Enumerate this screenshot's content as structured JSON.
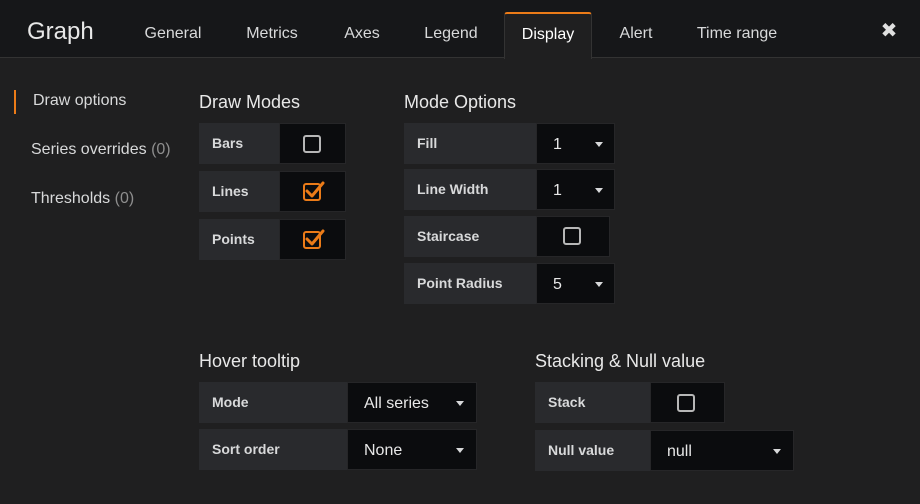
{
  "header": {
    "panel_title": "Graph",
    "tabs": [
      {
        "label": "General"
      },
      {
        "label": "Metrics"
      },
      {
        "label": "Axes"
      },
      {
        "label": "Legend"
      },
      {
        "label": "Display",
        "active": true
      },
      {
        "label": "Alert"
      },
      {
        "label": "Time range"
      }
    ],
    "close_glyph": "✖"
  },
  "sidebar": {
    "items": [
      {
        "label": "Draw options",
        "count": "",
        "active": true
      },
      {
        "label": "Series overrides",
        "count": "(0)"
      },
      {
        "label": "Thresholds",
        "count": "(0)"
      }
    ]
  },
  "draw_modes": {
    "title": "Draw Modes",
    "bars": {
      "label": "Bars",
      "checked": false
    },
    "lines": {
      "label": "Lines",
      "checked": true
    },
    "points": {
      "label": "Points",
      "checked": true
    }
  },
  "mode_options": {
    "title": "Mode Options",
    "fill": {
      "label": "Fill",
      "value": "1"
    },
    "line_width": {
      "label": "Line Width",
      "value": "1"
    },
    "staircase": {
      "label": "Staircase",
      "checked": false
    },
    "point_radius": {
      "label": "Point Radius",
      "value": "5"
    }
  },
  "hover_tooltip": {
    "title": "Hover tooltip",
    "mode": {
      "label": "Mode",
      "value": "All series"
    },
    "sort_order": {
      "label": "Sort order",
      "value": "None"
    }
  },
  "stacking": {
    "title": "Stacking & Null value",
    "stack": {
      "label": "Stack",
      "checked": false
    },
    "null_value": {
      "label": "Null value",
      "value": "null"
    }
  },
  "colors": {
    "accent": "#eb7b18",
    "background": "#1f1f20",
    "header": "#161719"
  }
}
